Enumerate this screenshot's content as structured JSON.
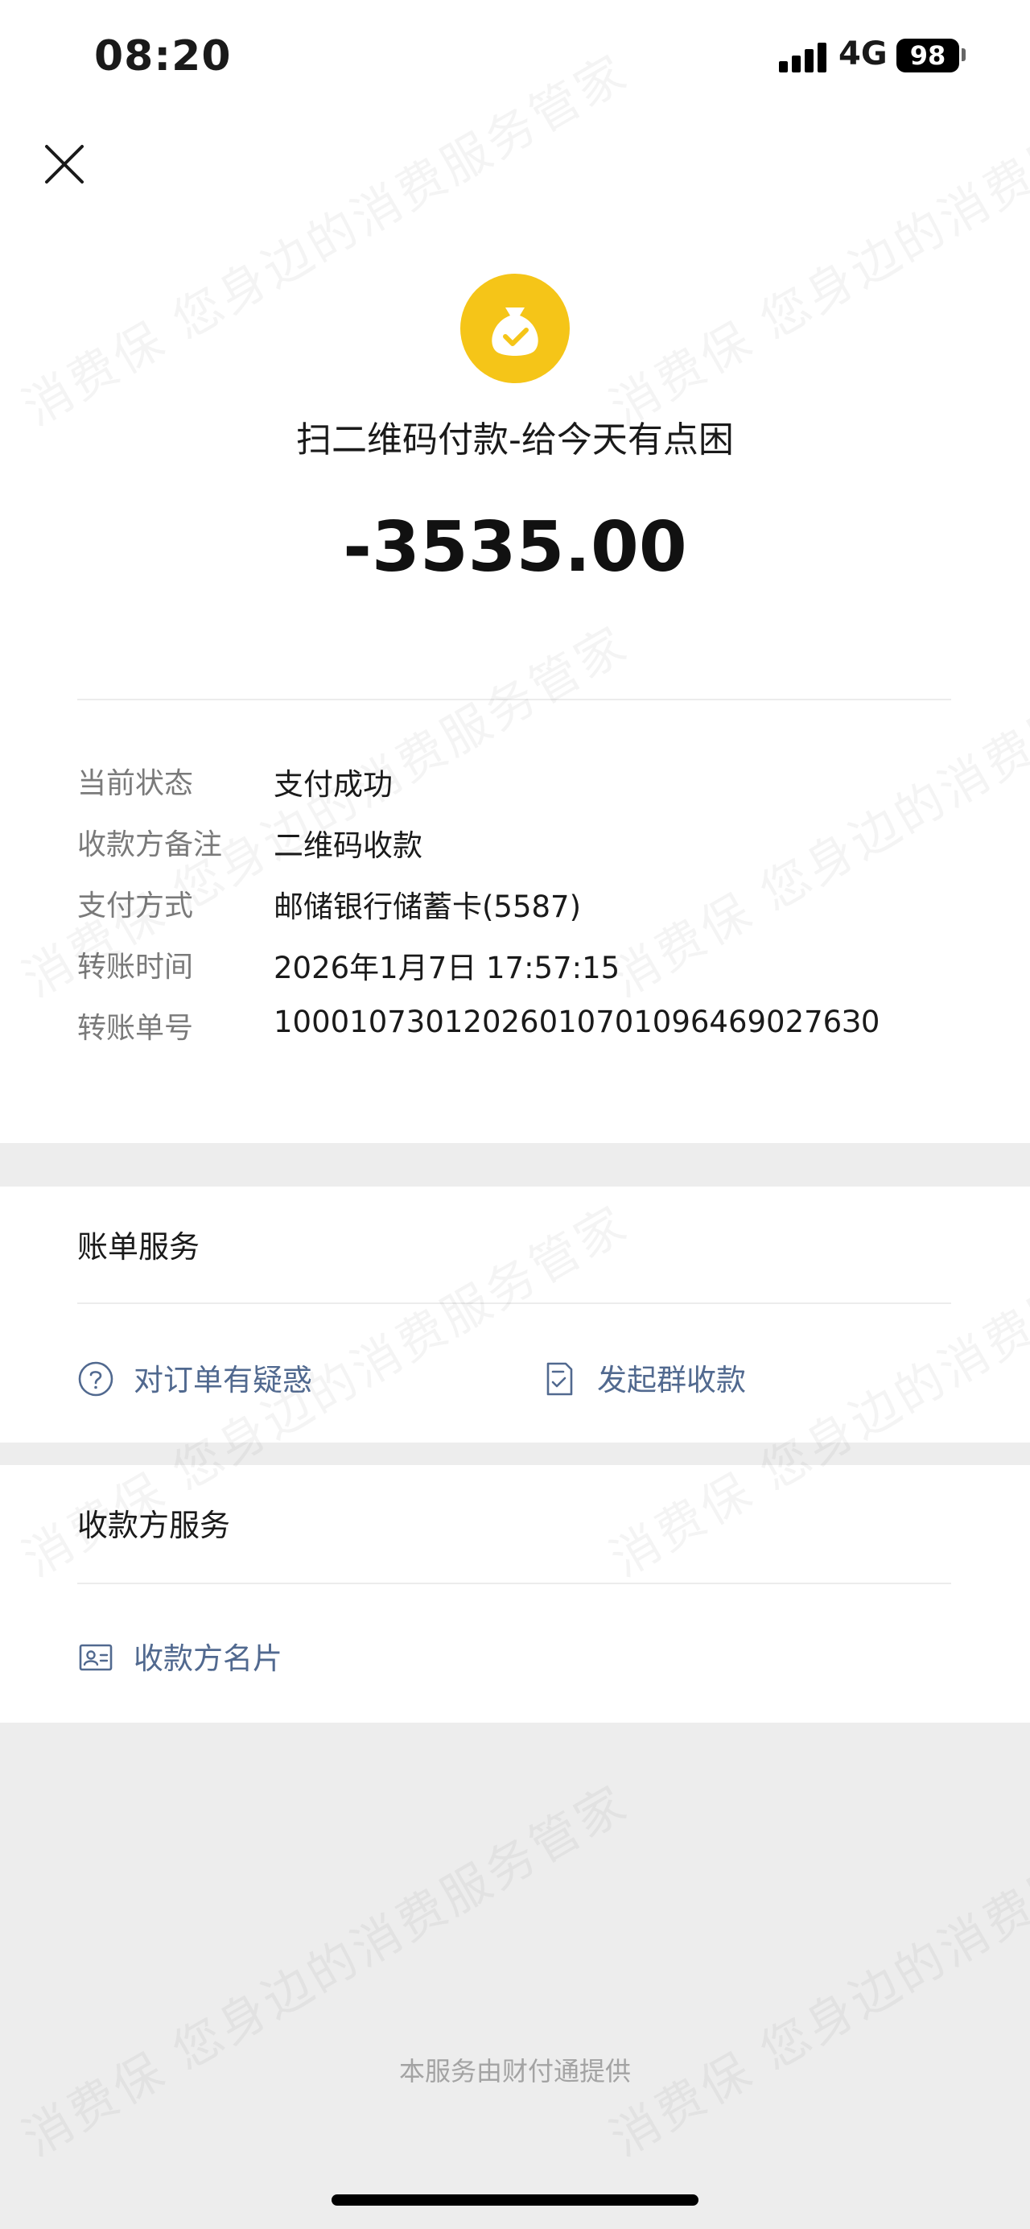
{
  "status_bar": {
    "time": "08:20",
    "network": "4G",
    "battery": "98"
  },
  "payment": {
    "title": "扫二维码付款-给今天有点困",
    "amount": "-3535.00",
    "icon": "money-bag-check-icon",
    "icon_color": "#f5c518"
  },
  "details": [
    {
      "label": "当前状态",
      "value": "支付成功"
    },
    {
      "label": "收款方备注",
      "value": "二维码收款"
    },
    {
      "label": "支付方式",
      "value": "邮储银行储蓄卡(5587)"
    },
    {
      "label": "转账时间",
      "value": "2026年1月7日 17:57:15"
    },
    {
      "label": "转账单号",
      "value": "100010730120260107010964690276З0"
    }
  ],
  "bill_service": {
    "title": "账单服务",
    "actions": [
      {
        "label": "对订单有疑惑",
        "icon": "question-circle-icon"
      },
      {
        "label": "发起群收款",
        "icon": "checklist-document-icon"
      }
    ]
  },
  "payee_service": {
    "title": "收款方服务",
    "actions": [
      {
        "label": "收款方名片",
        "icon": "contact-card-icon"
      }
    ]
  },
  "footer": {
    "note": "本服务由财付通提供"
  },
  "watermark": {
    "text": "消费保 您身边的消费服务管家"
  },
  "colors": {
    "link": "#51698f",
    "accent": "#f5c518",
    "background": "#ededed"
  }
}
